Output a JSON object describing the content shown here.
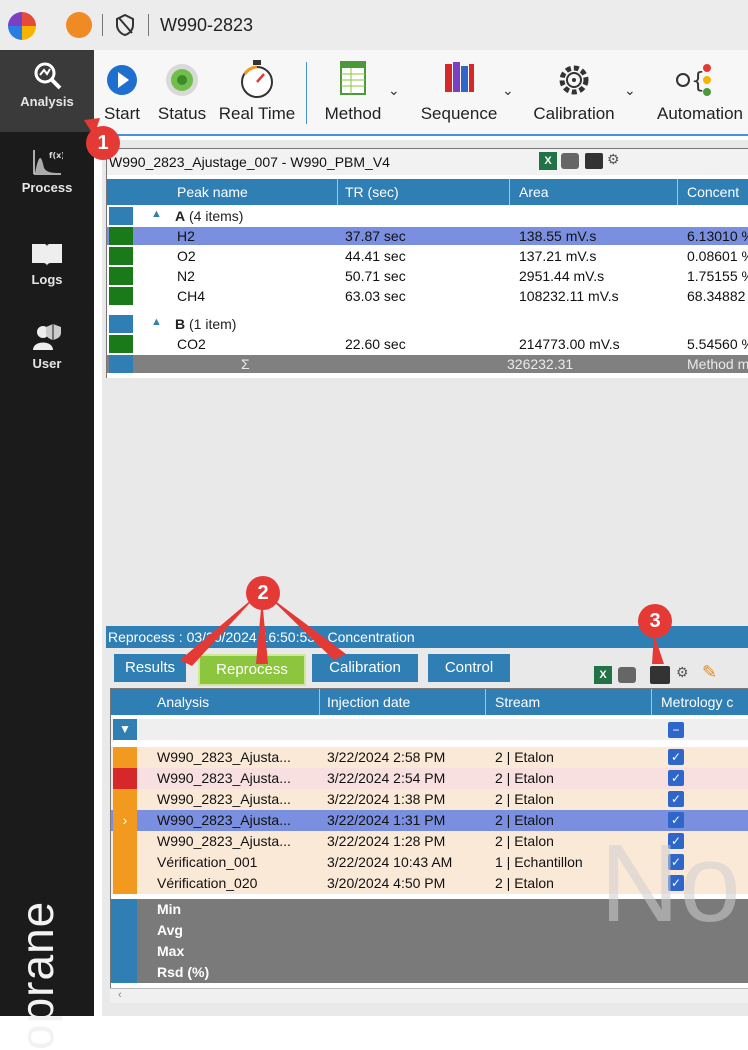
{
  "window": {
    "title": "W990-2823"
  },
  "nav": {
    "items": [
      {
        "label": "Analysis",
        "icon": "analysis-icon"
      },
      {
        "label": "Process",
        "icon": "process-icon"
      },
      {
        "label": "Logs",
        "icon": "book-icon"
      },
      {
        "label": "User",
        "icon": "user-icon"
      }
    ],
    "brand_text": "oprane"
  },
  "toolbar": {
    "start": "Start",
    "status": "Status",
    "realtime": "Real Time",
    "method": "Method",
    "sequence": "Sequence",
    "calibration": "Calibration",
    "automation": "Automation"
  },
  "results_panel": {
    "title": "W990_2823_Ajustage_007 - W990_PBM_V4",
    "columns": [
      "Peak name",
      "TR (sec)",
      "Area",
      "Concent"
    ],
    "groups": [
      {
        "label": "A",
        "count": "(4 items)",
        "rows": [
          {
            "peak": "H2",
            "tr": "37.87 sec",
            "area": "138.55 mV.s",
            "conc": "6.13010 %"
          },
          {
            "peak": "O2",
            "tr": "44.41 sec",
            "area": "137.21 mV.s",
            "conc": "0.08601 %"
          },
          {
            "peak": "N2",
            "tr": "50.71 sec",
            "area": "2951.44 mV.s",
            "conc": "1.75155 %"
          },
          {
            "peak": "CH4",
            "tr": "63.03 sec",
            "area": "108232.11 mV.s",
            "conc": "68.34882"
          }
        ]
      },
      {
        "label": "B",
        "count": "(1 item)",
        "rows": [
          {
            "peak": "CO2",
            "tr": "22.60 sec",
            "area": "214773.00 mV.s",
            "conc": "5.54560 %"
          }
        ]
      }
    ],
    "sum_symbol": "Σ",
    "sum_area": "326232.31",
    "sum_conc": "Method m"
  },
  "reprocess_panel": {
    "title": "Reprocess : 03/20/2024 16:50:53 - Concentration",
    "tabs": [
      "Results",
      "Reprocess",
      "Calibration",
      "Control"
    ],
    "columns": [
      "Analysis",
      "Injection date",
      "Stream",
      "Metrology c"
    ],
    "rows": [
      {
        "analysis": "W990_2823_Ajusta...",
        "date": "3/22/2024 2:58 PM",
        "stream": "2 | Etalon",
        "marker": "#f29a1f",
        "bg": "#fbe9d8",
        "checked": true
      },
      {
        "analysis": "W990_2823_Ajusta...",
        "date": "3/22/2024 2:54 PM",
        "stream": "2 | Etalon",
        "marker": "#d62828",
        "bg": "#f8e0e0",
        "checked": true
      },
      {
        "analysis": "W990_2823_Ajusta...",
        "date": "3/22/2024 1:38 PM",
        "stream": "2 | Etalon",
        "marker": "#f29a1f",
        "bg": "#fbe9d8",
        "checked": true
      },
      {
        "analysis": "W990_2823_Ajusta...",
        "date": "3/22/2024 1:31 PM",
        "stream": "2 | Etalon",
        "marker": "#f29a1f",
        "bg": "#7b8fe0",
        "checked": true,
        "selected": true
      },
      {
        "analysis": "W990_2823_Ajusta...",
        "date": "3/22/2024 1:28 PM",
        "stream": "2 | Etalon",
        "marker": "#f29a1f",
        "bg": "#fbe9d8",
        "checked": true
      },
      {
        "analysis": "Vérification_001",
        "date": "3/22/2024 10:43 AM",
        "stream": "1 | Echantillon",
        "marker": "#f29a1f",
        "bg": "#fbe9d8",
        "checked": true
      },
      {
        "analysis": "Vérification_020",
        "date": "3/20/2024 4:50 PM",
        "stream": "2 | Etalon",
        "marker": "#f29a1f",
        "bg": "#fbe9d8",
        "checked": true
      }
    ],
    "stats": [
      "Min",
      "Avg",
      "Max",
      "Rsd (%)"
    ],
    "watermark": "No"
  },
  "callouts": [
    "1",
    "2",
    "3"
  ],
  "colors": {
    "accent": "#2f7fb5",
    "tab_active": "#8cc63f",
    "callout": "#e53935"
  }
}
